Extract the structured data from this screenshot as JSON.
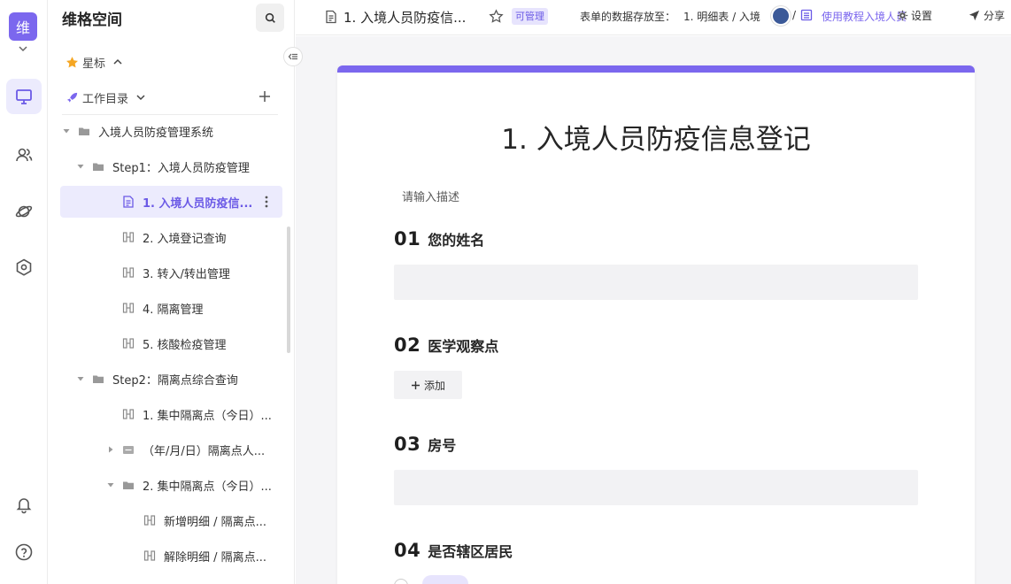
{
  "rail": {
    "space_avatar": "维",
    "icons": [
      "chevron-down-icon",
      "desktop-icon",
      "users-icon",
      "planet-icon",
      "hexagon-icon",
      "bell-icon",
      "help-icon"
    ]
  },
  "sidebar": {
    "space_title": "维格空间",
    "starred_label": "星标",
    "catalog_label": "工作目录",
    "tree": [
      {
        "label": "入境人员防疫管理系统",
        "type": "folder",
        "expanded": true,
        "level": 0
      },
      {
        "label": "Step1：入境人员防疫管理",
        "type": "folder",
        "expanded": true,
        "level": 1
      },
      {
        "label": "1. 入境人员防疫信...",
        "type": "form",
        "selected": true,
        "level": 2
      },
      {
        "label": "2. 入境登记查询",
        "type": "datasheet",
        "level": 2
      },
      {
        "label": "3. 转入/转出管理",
        "type": "datasheet",
        "level": 2
      },
      {
        "label": "4. 隔离管理",
        "type": "datasheet",
        "level": 2
      },
      {
        "label": "5. 核酸检疫管理",
        "type": "datasheet",
        "level": 2
      },
      {
        "label": "Step2：隔离点综合查询",
        "type": "folder",
        "expanded": true,
        "level": 1
      },
      {
        "label": "1. 集中隔离点（今日）...",
        "type": "datasheet",
        "level": 2
      },
      {
        "label": "（年/月/日）隔离点人...",
        "type": "folder-closed",
        "level": 2
      },
      {
        "label": "2. 集中隔离点（今日）...",
        "type": "folder",
        "expanded": true,
        "level": 2
      },
      {
        "label": "新增明细 / 隔离点...",
        "type": "datasheet",
        "level": 3
      },
      {
        "label": "解除明细 / 隔离点...",
        "type": "datasheet",
        "level": 3
      }
    ]
  },
  "topbar": {
    "title": "1. 入境人员防疫信...",
    "badge": "可管理",
    "storage_label": "表单的数据存放至：",
    "storage_path": "1. 明细表 / 入境",
    "slash": "/",
    "tutorial": "使用教程入境人员",
    "settings": "设置",
    "share": "分享"
  },
  "form": {
    "title": "1. 入境人员防疫信息登记",
    "description": "请输入描述",
    "add_label": "添加",
    "questions": [
      {
        "num": "01",
        "label": "您的姓名"
      },
      {
        "num": "02",
        "label": "医学观察点"
      },
      {
        "num": "03",
        "label": "房号"
      },
      {
        "num": "04",
        "label": "是否辖区居民"
      }
    ]
  },
  "colors": {
    "accent": "#7b67ee",
    "selected_bg": "#ecebfd",
    "badge_bg": "#e7e4fd"
  }
}
